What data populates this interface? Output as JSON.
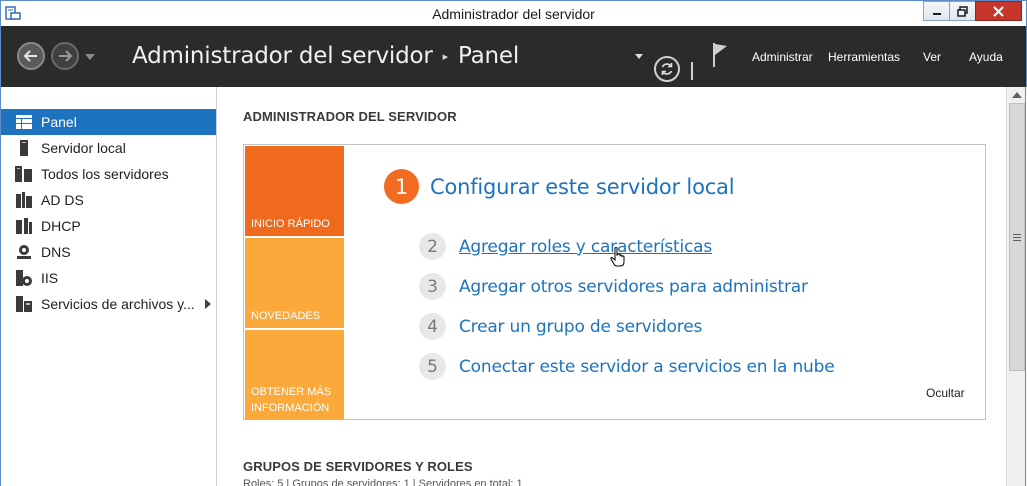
{
  "window": {
    "title": "Administrador del servidor",
    "min_label": "_",
    "max_label": "□",
    "close_label": "✕"
  },
  "header": {
    "app_name": "Administrador del servidor",
    "separator": "▸",
    "current_page": "Panel",
    "menu": [
      "Administrar",
      "Herramientas",
      "Ver",
      "Ayuda"
    ]
  },
  "sidebar": {
    "items": [
      {
        "label": "Panel",
        "icon": "dashboard-icon",
        "active": true
      },
      {
        "label": "Servidor local",
        "icon": "server-icon"
      },
      {
        "label": "Todos los servidores",
        "icon": "servers-icon"
      },
      {
        "label": "AD DS",
        "icon": "ad-ds-icon"
      },
      {
        "label": "DHCP",
        "icon": "dhcp-icon"
      },
      {
        "label": "DNS",
        "icon": "dns-icon"
      },
      {
        "label": "IIS",
        "icon": "iis-icon"
      },
      {
        "label": "Servicios de archivos y...",
        "icon": "file-services-icon",
        "expandable": true
      }
    ]
  },
  "main": {
    "section1_title": "ADMINISTRADOR DEL SERVIDOR",
    "tiles": [
      "INICIO RÁPIDO",
      "NOVEDADES",
      "OBTENER MÁS INFORMACIÓN"
    ],
    "main_step": {
      "number": "1",
      "label": "Configurar este servidor local"
    },
    "steps": [
      {
        "number": "2",
        "label": "Agregar roles y características"
      },
      {
        "number": "3",
        "label": "Agregar otros servidores para administrar"
      },
      {
        "number": "4",
        "label": "Crear un grupo de servidores"
      },
      {
        "number": "5",
        "label": "Conectar este servidor a servicios en la nube"
      }
    ],
    "hide_label": "Ocultar",
    "section2_title": "GRUPOS DE SERVIDORES Y ROLES",
    "stats": "Roles: 5   |   Grupos de servidores: 1   |   Servidores en total: 1"
  },
  "colors": {
    "accent": "#1e73be",
    "tile_primary": "#f06a1e",
    "tile_secondary": "#faa93a",
    "header_bg": "#2b2b2b"
  }
}
